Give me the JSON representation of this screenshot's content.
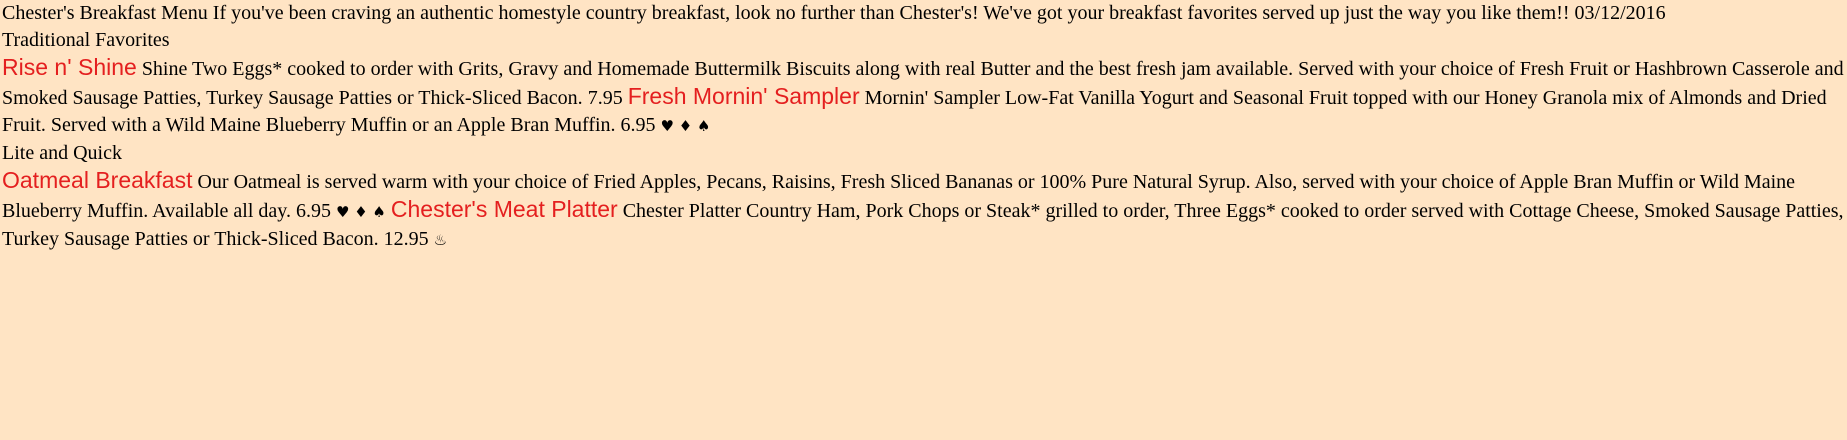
{
  "header": {
    "title": "Chester's Breakfast Menu",
    "intro": "If you've been craving an authentic homestyle country breakfast, look no further than Chester's! We've got your breakfast favorites served up just the way you like them!!",
    "date": "03/12/2016"
  },
  "sections": [
    {
      "heading": "Traditional Favorites",
      "items": [
        {
          "name": "Rise n' Shine",
          "short": "Shine",
          "description": "Two Eggs* cooked to order with Grits, Gravy and Homemade Buttermilk Biscuits along with real Butter and the best fresh jam available. Served with your choice of Fresh Fruit or Hashbrown Casserole and Smoked Sausage Patties, Turkey Sausage Patties or Thick-Sliced Bacon.",
          "price": "7.95",
          "icons": ""
        },
        {
          "name": "Fresh Mornin' Sampler",
          "short": "Mornin' Sampler",
          "description": "Low-Fat Vanilla Yogurt and Seasonal Fruit topped with our Honey Granola mix of Almonds and Dried Fruit. Served with a Wild Maine Blueberry Muffin or an Apple Bran Muffin.",
          "price": "6.95",
          "icons": "♥ ♦ ♠"
        }
      ]
    },
    {
      "heading": "Lite and Quick",
      "items": [
        {
          "name": "Oatmeal Breakfast",
          "short": "",
          "description": "Our Oatmeal is served warm with your choice of Fried Apples, Pecans, Raisins, Fresh Sliced Bananas or 100% Pure Natural Syrup. Also, served with your choice of Apple Bran Muffin or Wild Maine Blueberry Muffin. Available all day.",
          "price": "6.95",
          "icons": "♥ ♦ ♠"
        },
        {
          "name": "Chester's Meat Platter",
          "short": "Chester Platter",
          "description": "Country Ham, Pork Chops or Steak* grilled to order, Three Eggs* cooked to order served with Cottage Cheese, Smoked Sausage Patties, Turkey Sausage Patties or Thick-Sliced Bacon.",
          "price": "12.95",
          "icons": "♨"
        }
      ]
    }
  ]
}
